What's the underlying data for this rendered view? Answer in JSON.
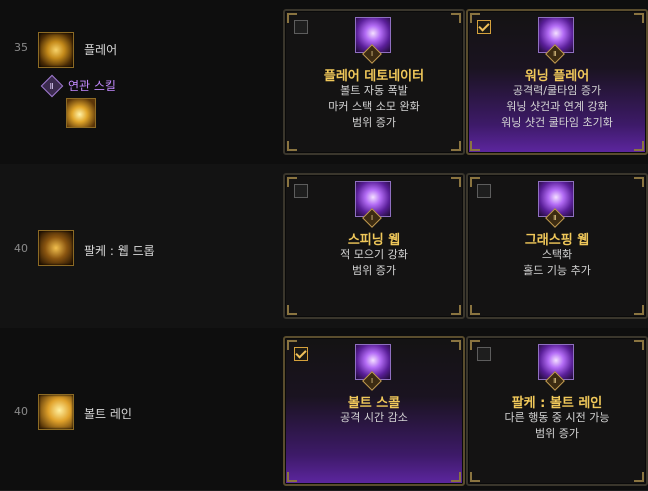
{
  "rows": [
    {
      "level": "35",
      "skill_name": "플레어",
      "skill_icon": "flare-icon",
      "related": {
        "badge": "Ⅱ",
        "label": "연관 스킬",
        "icon": "flare-related-icon"
      },
      "cards": [
        {
          "title": "플레어 데토네이터",
          "lines": [
            "볼트 자동 폭발",
            "마커 스택 소모 완화",
            "범위 증가"
          ],
          "checked": false,
          "tier": "Ⅰ",
          "icon": "flare-detonator-icon"
        },
        {
          "title": "워닝 플레어",
          "lines": [
            "공격력/쿨타임 증가",
            "워닝 샷건과 연계 강화",
            "워닝 샷건 쿨타임 초기화"
          ],
          "checked": true,
          "tier": "Ⅱ",
          "icon": "warning-flare-icon"
        }
      ]
    },
    {
      "level": "40",
      "skill_name": "팔케 : 웹 드롭",
      "skill_icon": "web-drop-icon",
      "cards": [
        {
          "title": "스피닝 웹",
          "lines": [
            "적 모으기 강화",
            "범위 증가"
          ],
          "checked": false,
          "tier": "Ⅰ",
          "icon": "spinning-web-icon"
        },
        {
          "title": "그래스핑 웹",
          "lines": [
            "스택화",
            "홀드 기능 추가"
          ],
          "checked": false,
          "tier": "Ⅱ",
          "icon": "grasping-web-icon"
        }
      ]
    },
    {
      "level": "40",
      "skill_name": "볼트 레인",
      "skill_icon": "bolt-rain-icon",
      "cards": [
        {
          "title": "볼트 스콜",
          "lines": [
            "공격 시간 감소"
          ],
          "checked": true,
          "tier": "Ⅰ",
          "icon": "bolt-squall-icon"
        },
        {
          "title": "팔케 : 볼트 레인",
          "lines": [
            "다른 행동 중 시전 가능",
            "범위 증가"
          ],
          "checked": false,
          "tier": "Ⅱ",
          "icon": "falke-bolt-rain-icon"
        }
      ]
    }
  ],
  "colors": {
    "accent_gold": "#f0c85a",
    "accent_purple": "#c38aff",
    "selected_glow": "#5d26a0"
  }
}
